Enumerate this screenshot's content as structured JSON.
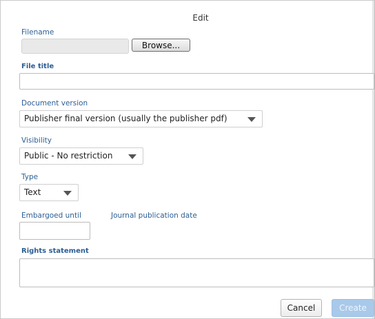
{
  "dialog": {
    "title": "Edit"
  },
  "filename": {
    "label": "Filename",
    "browse_label": "Browse..."
  },
  "file_title": {
    "label": "File title",
    "value": ""
  },
  "document_version": {
    "label": "Document version",
    "selected": "Publisher final version (usually the publisher pdf)"
  },
  "visibility": {
    "label": "Visibility",
    "selected": "Public - No restriction"
  },
  "type": {
    "label": "Type",
    "selected": "Text"
  },
  "embargo": {
    "label": "Embargoed until",
    "value": ""
  },
  "journal_date": {
    "label": "Journal publication date"
  },
  "rights": {
    "label": "Rights statement",
    "value": ""
  },
  "actions": {
    "cancel_label": "Cancel",
    "create_label": "Create"
  },
  "colors": {
    "label_blue": "#2c5e93",
    "create_bg": "#a9c9ea"
  },
  "icons": {
    "dropdown": "chevron-down-icon"
  }
}
